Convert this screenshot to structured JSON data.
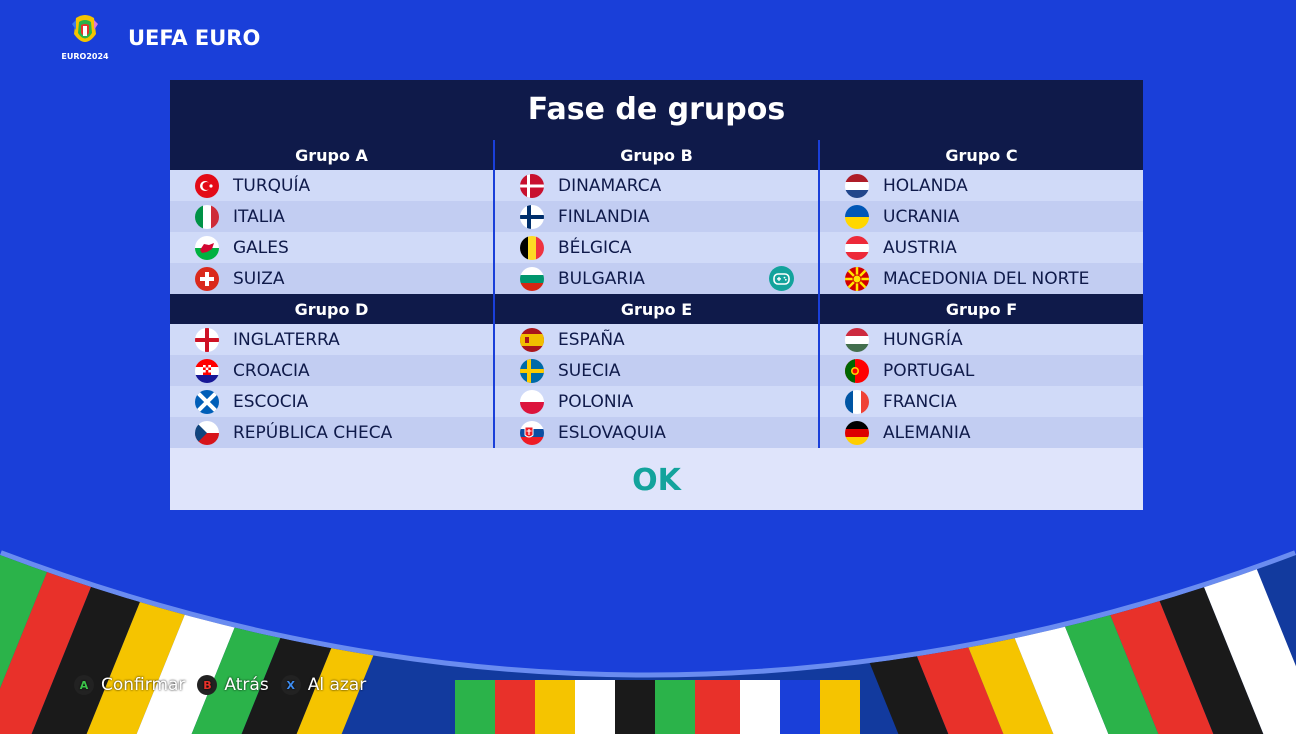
{
  "app": {
    "title": "UEFA EURO",
    "logo_text": "EURO2024"
  },
  "panel": {
    "title": "Fase de grupos",
    "ok_label": "OK"
  },
  "groups": [
    {
      "name": "Grupo A",
      "teams": [
        "TURQUÍA",
        "ITALIA",
        "GALES",
        "SUIZA"
      ]
    },
    {
      "name": "Grupo B",
      "teams": [
        "DINAMARCA",
        "FINLANDIA",
        "BÉLGICA",
        "BULGARIA"
      ]
    },
    {
      "name": "Grupo C",
      "teams": [
        "HOLANDA",
        "UCRANIA",
        "AUSTRIA",
        "MACEDONIA DEL NORTE"
      ]
    },
    {
      "name": "Grupo D",
      "teams": [
        "INGLATERRA",
        "CROACIA",
        "ESCOCIA",
        "REPÚBLICA CHECA"
      ]
    },
    {
      "name": "Grupo E",
      "teams": [
        "ESPAÑA",
        "SUECIA",
        "POLONIA",
        "ESLOVAQUIA"
      ]
    },
    {
      "name": "Grupo F",
      "teams": [
        "HUNGRÍA",
        "PORTUGAL",
        "FRANCIA",
        "ALEMANIA"
      ]
    }
  ],
  "footer": {
    "confirm": {
      "key": "A",
      "label": "Confirmar"
    },
    "back": {
      "key": "B",
      "label": "Atrás"
    },
    "random": {
      "key": "X",
      "label": "Al azar"
    }
  },
  "colors": {
    "background": "#1a3fd9",
    "panel_dark": "#0f1a4a",
    "accent": "#13a39c"
  }
}
